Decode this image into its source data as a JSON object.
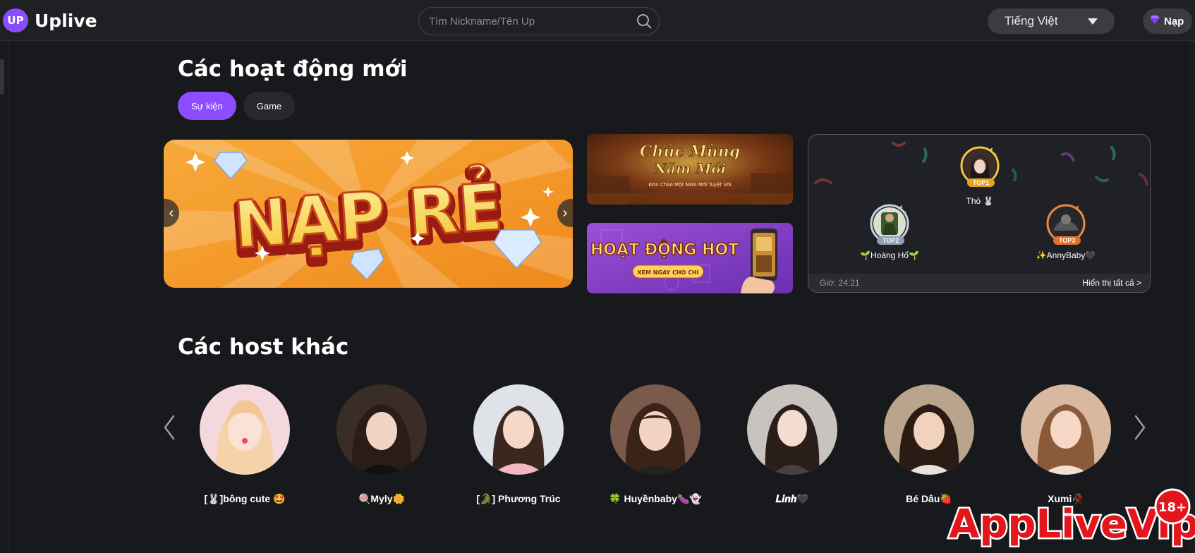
{
  "app": {
    "logo_mark": "UP",
    "name": "Uplive"
  },
  "search": {
    "placeholder": "Tìm Nickname/Tên Up",
    "value": ""
  },
  "language": {
    "selected": "Tiếng Việt"
  },
  "topup": {
    "label": "Nạp",
    "icon": "diamond-icon"
  },
  "activities": {
    "title": "Các hoạt động mới",
    "tabs": [
      {
        "label": "Sự kiện",
        "active": true
      },
      {
        "label": "Game",
        "active": false
      }
    ],
    "main_banner": {
      "text": "NẠP RẺ"
    },
    "small_banners": [
      {
        "title": "Chúc Mừng",
        "title2": "Năm Mới",
        "subtitle": "Đón Chào Một Năm Mới Tuyệt Vời"
      },
      {
        "title": "HOẠT ĐỘNG HOT",
        "button": "XEM NGAY CHO CHI"
      }
    ],
    "ranking": {
      "top": [
        {
          "badge": "TOP1",
          "name": "Thỏ 🐰"
        },
        {
          "badge": "TOP2",
          "name": "🌱Hoàng Hổ🌱"
        },
        {
          "badge": "TOP3",
          "name": "✨AnnyBaby🖤"
        }
      ],
      "time": "Giờ: 24:21",
      "view_all": "Hiển thị tất cả >"
    }
  },
  "hosts": {
    "title": "Các host khác",
    "items": [
      {
        "name": "[🐰]bông cute 🤩"
      },
      {
        "name": "🍭Myly🌼"
      },
      {
        "name": "[🐊] Phương Trúc"
      },
      {
        "name": "🍀 Huyềnbaby🍆👻"
      },
      {
        "name": "𝑳𝒊𝒏𝒉🖤"
      },
      {
        "name": "Bé Dâu🍓"
      },
      {
        "name": "Xumi🥀"
      }
    ]
  },
  "watermark": {
    "text": "AppLiveVip",
    "badge": "18+"
  },
  "colors": {
    "accent": "#8b4dff",
    "background": "#18191d",
    "topbar": "#1f2024"
  }
}
